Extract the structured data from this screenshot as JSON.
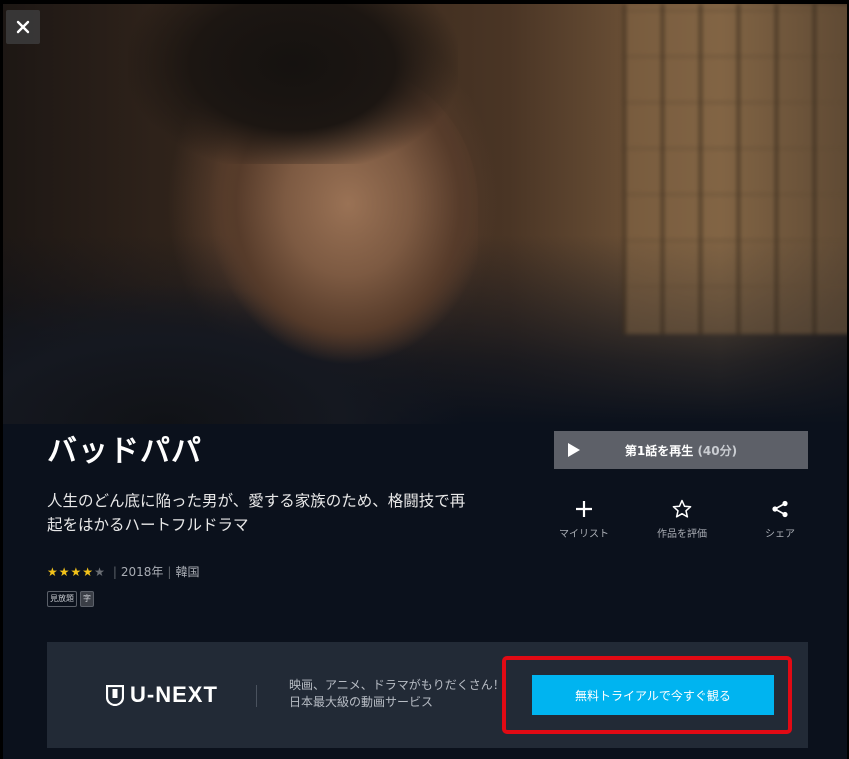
{
  "close_button": {
    "icon": "close-icon"
  },
  "title": {
    "text": "バッドパパ"
  },
  "synopsis": {
    "text": "人生のどん底に陥った男が、愛する家族のため、格闘技で再起をはかるハートフルドラマ"
  },
  "meta": {
    "rating": 4,
    "rating_max": 5,
    "year": "2018年",
    "country": "韓国",
    "badges": [
      "見放題",
      "字"
    ]
  },
  "play_button": {
    "label": "第1話を再生",
    "duration": "(40分)",
    "icon": "play-icon"
  },
  "actions": [
    {
      "label": "マイリスト",
      "icon": "plus-icon"
    },
    {
      "label": "作品を評価",
      "icon": "star-outline-icon"
    },
    {
      "label": "シェア",
      "icon": "share-icon"
    }
  ],
  "banner": {
    "logo_text": "U-NEXT",
    "text_line1": "映画、アニメ、ドラマがもりだくさん！",
    "text_line2": "日本最大級の動画サービス",
    "cta_label": "無料トライアルで今すぐ観る"
  },
  "colors": {
    "background": "#0b111c",
    "banner": "#222a36",
    "cta": "#00b4f0",
    "highlight": "#e10a14",
    "star": "#f2c21a"
  }
}
